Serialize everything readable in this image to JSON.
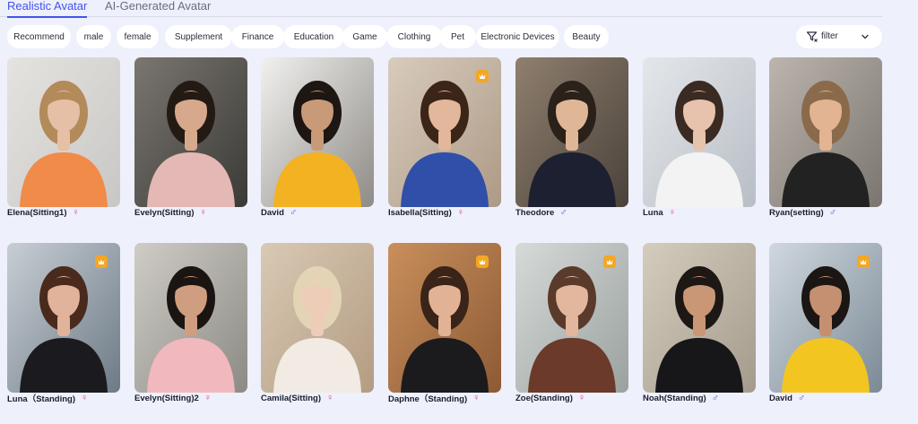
{
  "tabs": [
    {
      "label": "Realistic Avatar",
      "active": true
    },
    {
      "label": "AI-Generated Avatar",
      "active": false
    }
  ],
  "categories": [
    "Recommend",
    "male",
    "female",
    "Supplement",
    "Finance",
    "Education",
    "Game",
    "Clothing",
    "Pet",
    "Electronic Devices",
    "Beauty"
  ],
  "filter": {
    "label": "filter",
    "icon": "filter-icon",
    "chevron": "chevron-down-icon"
  },
  "colors": {
    "accent": "#4253ee",
    "female": "#e0479b",
    "male": "#4a63e6",
    "premium": "#f5a623",
    "background": "#eef0fb"
  },
  "avatars": [
    {
      "name": "Elena(Sitting1)",
      "gender": "female",
      "gender_symbol": "♀",
      "premium": false
    },
    {
      "name": "Evelyn(Sitting)",
      "gender": "female",
      "gender_symbol": "♀",
      "premium": false
    },
    {
      "name": "David",
      "gender": "male",
      "gender_symbol": "♂",
      "premium": false
    },
    {
      "name": "Isabella(Sitting)",
      "gender": "female",
      "gender_symbol": "♀",
      "premium": true
    },
    {
      "name": "Theodore",
      "gender": "male",
      "gender_symbol": "♂",
      "premium": false
    },
    {
      "name": "Luna",
      "gender": "female",
      "gender_symbol": "♀",
      "premium": false
    },
    {
      "name": "Ryan(setting)",
      "gender": "male",
      "gender_symbol": "♂",
      "premium": false
    },
    {
      "name": "Luna（Standing)",
      "gender": "female",
      "gender_symbol": "♀",
      "premium": true
    },
    {
      "name": "Evelyn(Sitting)2",
      "gender": "female",
      "gender_symbol": "♀",
      "premium": false
    },
    {
      "name": "Camila(Sitting)",
      "gender": "female",
      "gender_symbol": "♀",
      "premium": false
    },
    {
      "name": "Daphne（Standing)",
      "gender": "female",
      "gender_symbol": "♀",
      "premium": true
    },
    {
      "name": "Zoe(Standing)",
      "gender": "female",
      "gender_symbol": "♀",
      "premium": true
    },
    {
      "name": "Noah(Standing)",
      "gender": "male",
      "gender_symbol": "♂",
      "premium": false
    },
    {
      "name": "David",
      "gender": "male",
      "gender_symbol": "♂",
      "premium": true
    }
  ]
}
